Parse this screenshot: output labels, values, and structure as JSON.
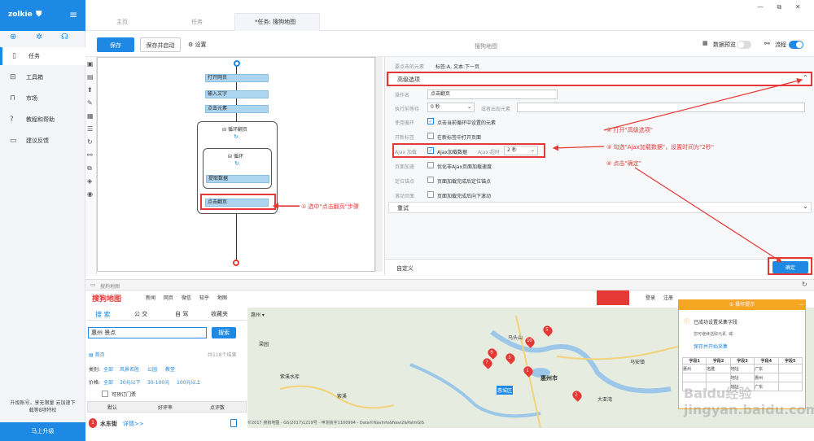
{
  "app": {
    "brand": "zolkie",
    "upgrade_promo": "升级账号，享无限量 云加速下载等8项特权",
    "upgrade_button": "马上升级"
  },
  "sidebar": {
    "items": [
      {
        "label": "任务",
        "icon": "file-icon",
        "active": true
      },
      {
        "label": "工具箱",
        "icon": "toolbox-icon",
        "active": false
      },
      {
        "label": "市场",
        "icon": "lock-icon",
        "active": false
      },
      {
        "label": "教程和帮助",
        "icon": "help-icon",
        "active": false
      },
      {
        "label": "建议反馈",
        "icon": "feedback-icon",
        "active": false
      }
    ]
  },
  "tabs": [
    {
      "label": "主页",
      "active": false
    },
    {
      "label": "任务",
      "active": false
    },
    {
      "label": "*任务: 搜狗地图",
      "active": true
    }
  ],
  "toolbar": {
    "save": "保存",
    "save_start": "保存并启动",
    "settings": "设置",
    "title": "搜狗地图",
    "data_preview": "数据预览",
    "flow": "流程",
    "data_preview_on": false,
    "flow_on": true
  },
  "workflow": {
    "steps": [
      "打开网页",
      "输入文字",
      "点击元素"
    ],
    "outer_loop": "循环翻页",
    "inner_loop": "循环",
    "extract": "提取数据",
    "click_page": "点击翻页"
  },
  "annotations": {
    "step1": "① 选中\"点击翻页\"步骤",
    "step2": "② 打开\"高级选项\"",
    "step3": "③ 勾选\"Ajax加载数据\"，设置时间为\"2秒\"",
    "step4": "④ 点击\"确定\""
  },
  "props": {
    "element_label": "要点击的元素",
    "element_value": "标签:A, 文本:下一页",
    "advanced": "高级选项",
    "op_name_label": "操作名",
    "op_name_value": "点击翻页",
    "wait_label": "执行前等待",
    "wait_value": "0 秒",
    "wait_element": "或者出现元素",
    "use_loop_label": "使用循环",
    "use_loop_text": "点击当前循环中设置的元素",
    "new_tab_label": "开新标签",
    "new_tab_text": "在新标签中打开页面",
    "ajax_label": "Ajax 加载",
    "ajax_text": "Ajax加载数据",
    "ajax_timeout_label": "Ajax 超时",
    "ajax_timeout_value": "2 秒",
    "page_speed_label": "页面加速",
    "page_speed_text": "优化非Ajax页面加载速度",
    "locate_label": "定位锚点",
    "locate_text": "页面加载完成后定位锚点",
    "scroll_label": "滚动页面",
    "scroll_text": "页面加载完成后向下滚动",
    "retry": "重试",
    "custom": "自定义",
    "confirm": "确定"
  },
  "browser": {
    "url": "搜狗地图"
  },
  "sogou": {
    "logo": "搜狗地图",
    "nav": [
      "新闻",
      "网页",
      "微信",
      "知乎",
      "地图"
    ],
    "search_tab": "搜 索",
    "bus_tab": "公 交",
    "drive_tab": "自 驾",
    "fav_tab": "收藏夹",
    "query": "惠州 景点",
    "search_btn": "搜索",
    "home": "首页",
    "result_count": "共118个结果",
    "category_label": "类别:",
    "categories": [
      "全部",
      "风景名胜",
      "公园",
      "教堂"
    ],
    "price_label": "价格:",
    "prices": [
      "全部",
      "30元以下",
      "30-100元",
      "100元以上"
    ],
    "ticket": "可预订门票",
    "sort": [
      "默认",
      "好评率",
      "点评数"
    ],
    "first_result": "水东街",
    "detail": "详情>>",
    "city": "惠州",
    "login": "登录",
    "register": "注册"
  },
  "map_labels": [
    "惠州市",
    "马头山",
    "梁园",
    "紫溪",
    "紫溪水库",
    "惠城区",
    "马安镇",
    "大亚湾"
  ],
  "tip": {
    "title": "① 操作提示",
    "line1": "已成功设置采集字段",
    "line2": "您可继续选取元素, 或:",
    "link": "保存并开始采集",
    "table_headers": [
      "字段1",
      "字段2",
      "字段3",
      "字段4",
      "字段5"
    ],
    "table_rows": [
      [
        "惠州",
        "名胜",
        "地址",
        "广东",
        ""
      ],
      [
        "",
        "",
        "地址",
        "惠州",
        ""
      ],
      [
        "",
        "",
        "地址",
        "广东",
        ""
      ]
    ]
  },
  "copyright": "©2017 搜狗地图 - GS(2017)1219号 - 甲测资字1100994 - Data©NavInfo&Navi2&PalmGIS",
  "watermark": "Baidu经验 jingyan.baidu.com"
}
